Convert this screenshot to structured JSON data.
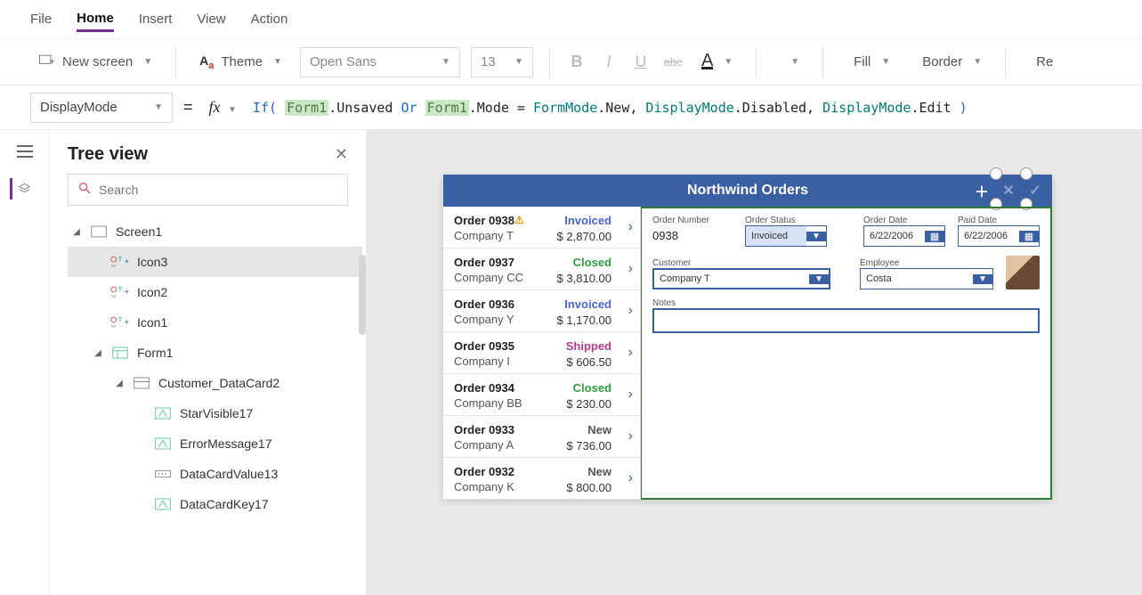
{
  "menu": {
    "file": "File",
    "home": "Home",
    "insert": "Insert",
    "view": "View",
    "action": "Action"
  },
  "ribbon": {
    "newScreen": "New screen",
    "theme": "Theme",
    "font": "Open Sans",
    "fontSize": "13",
    "fill": "Fill",
    "border": "Border",
    "reorder": "Re"
  },
  "fx": {
    "property": "DisplayMode",
    "tokens": {
      "if": "If(",
      "f1": "Form1",
      "unsaved": ".Unsaved ",
      "or": "Or ",
      "f1b": "Form1",
      "mode": ".Mode = ",
      "fm": "FormMode",
      "new": ".New, ",
      "dm1": "DisplayMode",
      "dis": ".Disabled, ",
      "dm2": "DisplayMode",
      "edit": ".Edit ",
      "close": ")"
    }
  },
  "panel": {
    "title": "Tree view",
    "searchPlaceholder": "Search",
    "nodes": {
      "screen": "Screen1",
      "icon3": "Icon3",
      "icon2": "Icon2",
      "icon1": "Icon1",
      "form": "Form1",
      "card": "Customer_DataCard2",
      "starv": "StarVisible17",
      "err": "ErrorMessage17",
      "dcv": "DataCardValue13",
      "dck": "DataCardKey17"
    }
  },
  "app": {
    "title": "Northwind Orders",
    "orders": [
      {
        "num": "Order 0938",
        "company": "Company T",
        "status": "Invoiced",
        "amount": "$ 2,870.00",
        "warn": true
      },
      {
        "num": "Order 0937",
        "company": "Company CC",
        "status": "Closed",
        "amount": "$ 3,810.00"
      },
      {
        "num": "Order 0936",
        "company": "Company Y",
        "status": "Invoiced",
        "amount": "$ 1,170.00"
      },
      {
        "num": "Order 0935",
        "company": "Company I",
        "status": "Shipped",
        "amount": "$ 606.50"
      },
      {
        "num": "Order 0934",
        "company": "Company BB",
        "status": "Closed",
        "amount": "$ 230.00"
      },
      {
        "num": "Order 0933",
        "company": "Company A",
        "status": "New",
        "amount": "$ 736.00"
      },
      {
        "num": "Order 0932",
        "company": "Company K",
        "status": "New",
        "amount": "$ 800.00"
      }
    ],
    "detail": {
      "labels": {
        "orderNumber": "Order Number",
        "orderStatus": "Order Status",
        "orderDate": "Order Date",
        "paidDate": "Paid Date",
        "customer": "Customer",
        "employee": "Employee",
        "notes": "Notes"
      },
      "orderNumber": "0938",
      "orderStatus": "Invoiced",
      "orderDate": "6/22/2006",
      "paidDate": "6/22/2006",
      "customer": "Company T",
      "employee": "Costa",
      "notes": ""
    }
  }
}
